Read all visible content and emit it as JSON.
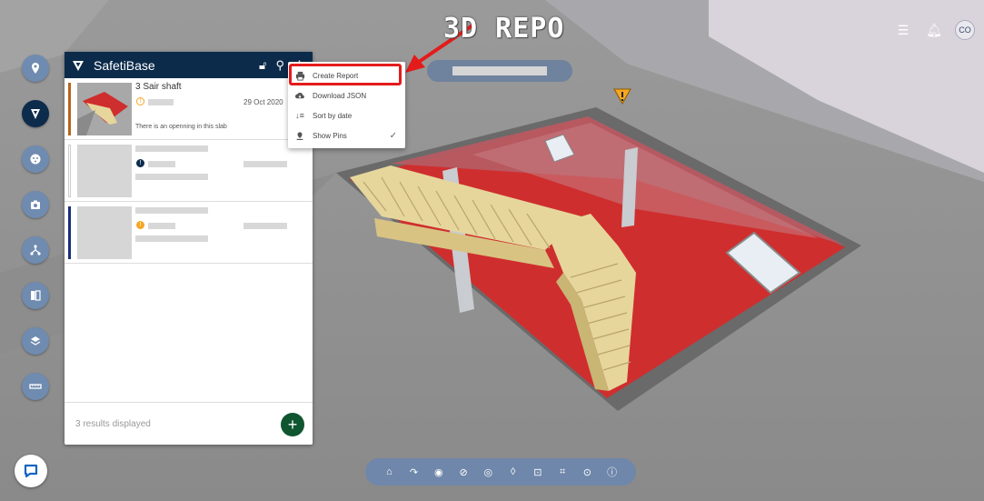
{
  "app": {
    "logo": "3D REPO",
    "user_initials": "CO"
  },
  "left_rail": [
    {
      "name": "rail-pin-button",
      "icon": "map-pin-icon"
    },
    {
      "name": "rail-safetibase-button",
      "icon": "safetibase-icon",
      "active": true
    },
    {
      "name": "rail-issues-button",
      "icon": "issues-icon"
    },
    {
      "name": "rail-camera-button",
      "icon": "camera-icon"
    },
    {
      "name": "rail-tree-button",
      "icon": "tree-icon"
    },
    {
      "name": "rail-compare-button",
      "icon": "compare-icon"
    },
    {
      "name": "rail-layers-button",
      "icon": "layers-icon"
    },
    {
      "name": "rail-measure-button",
      "icon": "ruler-icon"
    }
  ],
  "panel": {
    "title": "SafetiBase",
    "items": [
      {
        "name": "3 Sair shaft",
        "date": "29 Oct 2020",
        "description": "There is an openning in this slab",
        "status_color": "#f5a623",
        "stripe_color": "#b5651d"
      },
      {
        "name": "",
        "date": "",
        "description": "",
        "status_color": "#0d2c4c",
        "stripe_color": "#ffffff"
      },
      {
        "name": "",
        "date": "",
        "description": "",
        "status_color": "#f5a623",
        "stripe_color": "#1a2d7a"
      }
    ],
    "footer_count": "3 results displayed"
  },
  "menu": {
    "items": [
      {
        "label": "Create Report",
        "icon": "printer-icon"
      },
      {
        "label": "Download JSON",
        "icon": "cloud-download-icon"
      },
      {
        "label": "Sort by date",
        "icon": "sort-icon"
      },
      {
        "label": "Show Pins",
        "icon": "pin-icon",
        "checked": true
      }
    ]
  },
  "colors": {
    "accent": "#0c2b4b",
    "highlight": "#e41b1b",
    "fab": "#0f5530",
    "toolbar": "#6f87aa"
  }
}
